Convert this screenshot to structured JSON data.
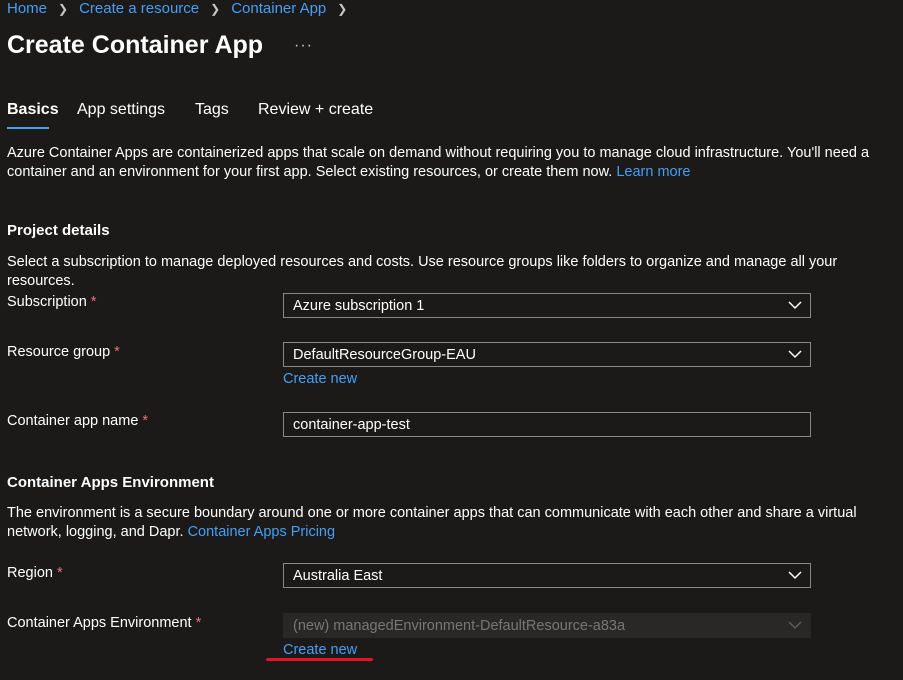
{
  "breadcrumb": [
    "Home",
    "Create a resource",
    "Container App"
  ],
  "page_title": "Create Container App",
  "more_label": "···",
  "tabs": [
    {
      "label": "Basics",
      "active": true
    },
    {
      "label": "App settings"
    },
    {
      "label": "Tags"
    },
    {
      "label": "Review + create"
    }
  ],
  "intro": {
    "text": "Azure Container Apps are containerized apps that scale on demand without requiring you to manage cloud infrastructure. You'll need a container and an environment for your first app. Select existing resources, or create them now.",
    "link": "Learn more"
  },
  "project": {
    "title": "Project details",
    "desc": "Select a subscription to manage deployed resources and costs. Use resource groups like folders to organize and manage all your resources."
  },
  "fields": {
    "subscription": {
      "label": "Subscription",
      "value": "Azure subscription 1"
    },
    "resource_group": {
      "label": "Resource group",
      "value": "DefaultResourceGroup-EAU",
      "create_new": "Create new"
    },
    "app_name": {
      "label": "Container app name",
      "value": "container-app-test"
    },
    "region": {
      "label": "Region",
      "value": "Australia East"
    },
    "environment": {
      "label": "Container Apps Environment",
      "value": "(new) managedEnvironment-DefaultResource-a83a",
      "create_new": "Create new"
    }
  },
  "env_section": {
    "title": "Container Apps Environment",
    "desc": "The environment is a secure boundary around one or more container apps that can communicate with each other and share a virtual network, logging, and Dapr.",
    "link": "Container Apps Pricing"
  },
  "required_mark": "*",
  "colors": {
    "background": "#1b1a19",
    "link": "#479ef5",
    "required": "#f1707b",
    "annotation": "#e81123"
  }
}
